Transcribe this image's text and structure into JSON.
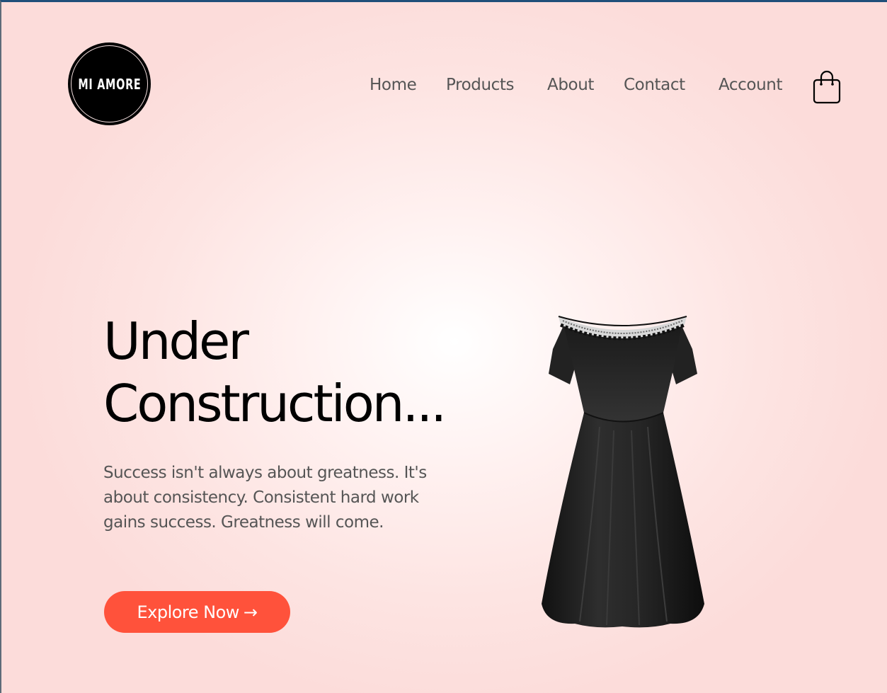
{
  "brand": {
    "logo_text": "MI AMORE"
  },
  "nav": {
    "items": [
      {
        "label": "Home"
      },
      {
        "label": "Products"
      },
      {
        "label": "About"
      },
      {
        "label": "Contact"
      },
      {
        "label": "Account"
      }
    ],
    "cart_icon": "shopping-bag-icon"
  },
  "hero": {
    "title_line1": "Under",
    "title_line2": "Construction...",
    "body": "Success isn't always about greatness. It's about consistency. Consistent hard work gains success. Greatness will come.",
    "cta_label": "Explore Now",
    "cta_arrow": "→",
    "image_subject": "black-dress"
  },
  "colors": {
    "accent": "#ff523b",
    "nav_text": "#555555",
    "background": "#fde0df"
  }
}
